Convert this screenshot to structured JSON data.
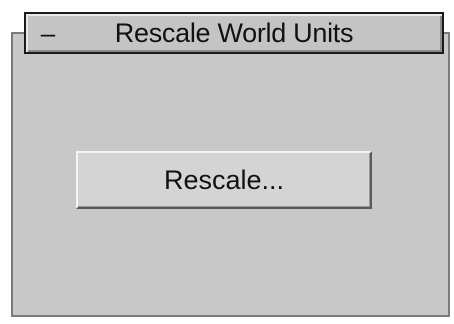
{
  "rollout": {
    "toggle_symbol": "–",
    "title": "Rescale World Units",
    "button_label": "Rescale..."
  },
  "colors": {
    "panel_background": "#c8c8c8",
    "header_background": "#c4c4c4",
    "header_border": "#1a1a1a",
    "frame_border": "#7a7a7a",
    "text": "#111111"
  },
  "icons": {
    "toggle": "minus-icon"
  }
}
